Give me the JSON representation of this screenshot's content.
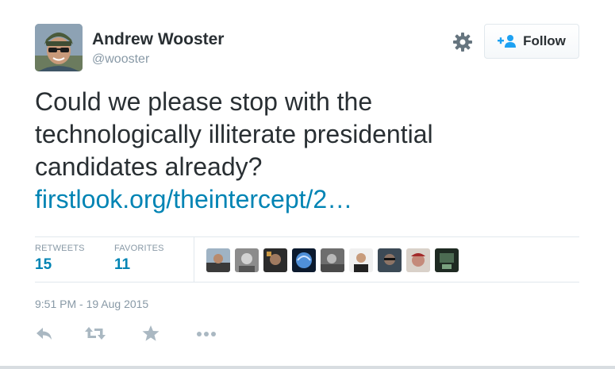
{
  "author": {
    "name": "Andrew Wooster",
    "handle": "@wooster",
    "avatar_icon": "user-avatar"
  },
  "header": {
    "settings_icon": "gear-icon",
    "follow_label": "Follow",
    "follow_icon": "add-user-icon"
  },
  "tweet": {
    "lines": [
      "Could we please stop with the",
      "technologically illiterate presidential",
      "candidates already?"
    ],
    "link": "firstlook.org/theintercept/2…"
  },
  "stats": {
    "retweets_label": "RETWEETS",
    "retweets_count": "15",
    "favorites_label": "FAVORITES",
    "favorites_count": "11"
  },
  "favoriters": [
    {
      "icon": "favoriter-avatar-1"
    },
    {
      "icon": "favoriter-avatar-2"
    },
    {
      "icon": "favoriter-avatar-3"
    },
    {
      "icon": "favoriter-avatar-4"
    },
    {
      "icon": "favoriter-avatar-5"
    },
    {
      "icon": "favoriter-avatar-6"
    },
    {
      "icon": "favoriter-avatar-7"
    },
    {
      "icon": "favoriter-avatar-8"
    },
    {
      "icon": "favoriter-avatar-9"
    }
  ],
  "timestamp": "9:51 PM - 19 Aug 2015",
  "actions": {
    "reply_icon": "reply-icon",
    "retweet_icon": "retweet-icon",
    "favorite_icon": "star-icon",
    "more_icon": "more-icon"
  },
  "colors": {
    "link": "#0084b4",
    "text": "#292f33",
    "muted": "#8899a6",
    "border": "#e1e8ed",
    "action_icon": "#aab8c2"
  }
}
